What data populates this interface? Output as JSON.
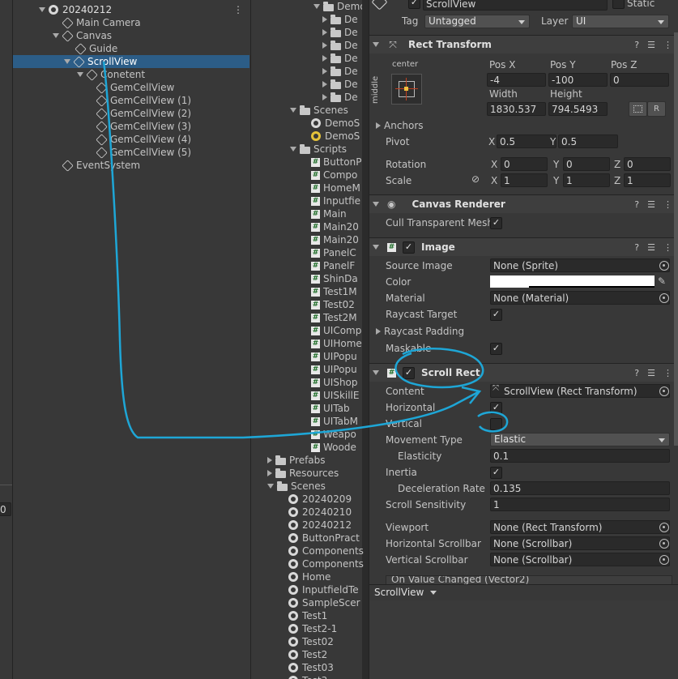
{
  "hierarchy": {
    "scene": "20240212",
    "items": [
      {
        "label": "Main Camera"
      },
      {
        "label": "Canvas"
      },
      {
        "label": "Guide"
      },
      {
        "label": "ScrollView"
      },
      {
        "label": "Conetent"
      },
      {
        "label": "GemCellView"
      },
      {
        "label": "GemCellView (1)"
      },
      {
        "label": "GemCellView (2)"
      },
      {
        "label": "GemCellView (3)"
      },
      {
        "label": "GemCellView (4)"
      },
      {
        "label": "GemCellView (5)"
      },
      {
        "label": "EventSystem"
      }
    ],
    "menu_glyph": "⋮"
  },
  "left_edge": {
    "value": "0"
  },
  "project": {
    "top_folder": "Demo",
    "demo_children": [
      "De",
      "De",
      "De",
      "De",
      "De",
      "De",
      "De"
    ],
    "scenes_label": "Scenes",
    "scenes_children": [
      "DemoS",
      "DemoS"
    ],
    "scripts_label": "Scripts",
    "scripts": [
      "ButtonP",
      "Compo",
      "HomeM",
      "Inputfie",
      "Main",
      "Main20",
      "Main20",
      "PanelC",
      "PanelF",
      "ShinDa",
      "Test1M",
      "Test02",
      "Test2M",
      "UIComp",
      "UIHome",
      "UIPopu",
      "UIPopu",
      "UIShop",
      "UISkillE",
      "UITab",
      "UITabM",
      "Weapo",
      "Woode"
    ],
    "folders": [
      "Prefabs",
      "Resources",
      "Scenes"
    ],
    "scenes": [
      "20240209",
      "20240210",
      "20240212",
      "ButtonPract",
      "Components",
      "Components",
      "Home",
      "InputfieldTe",
      "SampleScer",
      "Test1",
      "Test2-1",
      "Test02",
      "Test2",
      "Test03",
      "Test3"
    ]
  },
  "inspector": {
    "object_name": "ScrollView",
    "static_label": "Static",
    "tag_label": "Tag",
    "tag_value": "Untagged",
    "layer_label": "Layer",
    "layer_value": "UI",
    "rect_transform": {
      "title": "Rect Transform",
      "anchor_h": "center",
      "anchor_v": "middle",
      "pos_x_label": "Pos X",
      "pos_x": "-4",
      "pos_y_label": "Pos Y",
      "pos_y": "-100",
      "pos_z_label": "Pos Z",
      "pos_z": "0",
      "width_label": "Width",
      "width": "1830.537",
      "height_label": "Height",
      "height": "794.5493",
      "r_button": "R",
      "anchors_label": "Anchors",
      "pivot_label": "Pivot",
      "pivot_x": "0.5",
      "pivot_y": "0.5",
      "rotation_label": "Rotation",
      "rot_x": "0",
      "rot_y": "0",
      "rot_z": "0",
      "scale_label": "Scale",
      "scale_x": "1",
      "scale_y": "1",
      "scale_z": "1",
      "x": "X",
      "y": "Y",
      "z": "Z"
    },
    "canvas_renderer": {
      "title": "Canvas Renderer",
      "cull_label": "Cull Transparent Mesh"
    },
    "image": {
      "title": "Image",
      "source_label": "Source Image",
      "source_value": "None (Sprite)",
      "color_label": "Color",
      "material_label": "Material",
      "material_value": "None (Material)",
      "raycast_label": "Raycast Target",
      "padding_label": "Raycast Padding",
      "maskable_label": "Maskable"
    },
    "scroll_rect": {
      "title": "Scroll Rect",
      "content_label": "Content",
      "content_value": "ScrollView (Rect Transform)",
      "horizontal_label": "Horizontal",
      "vertical_label": "Vertical",
      "movement_label": "Movement Type",
      "movement_value": "Elastic",
      "elasticity_label": "Elasticity",
      "elasticity_value": "0.1",
      "inertia_label": "Inertia",
      "decel_label": "Deceleration Rate",
      "decel_value": "0.135",
      "sensitivity_label": "Scroll Sensitivity",
      "sensitivity_value": "1",
      "viewport_label": "Viewport",
      "viewport_value": "None (Rect Transform)",
      "hscroll_label": "Horizontal Scrollbar",
      "hscroll_value": "None (Scrollbar)",
      "vscroll_label": "Vertical Scrollbar",
      "vscroll_value": "None (Scrollbar)",
      "on_value_changed": "On Value Changed (Vector2)"
    },
    "bottom_tab": "ScrollView"
  },
  "colors": {
    "selection": "#2c5d87",
    "annotation": "#1ea6d6",
    "background": "#383838"
  }
}
